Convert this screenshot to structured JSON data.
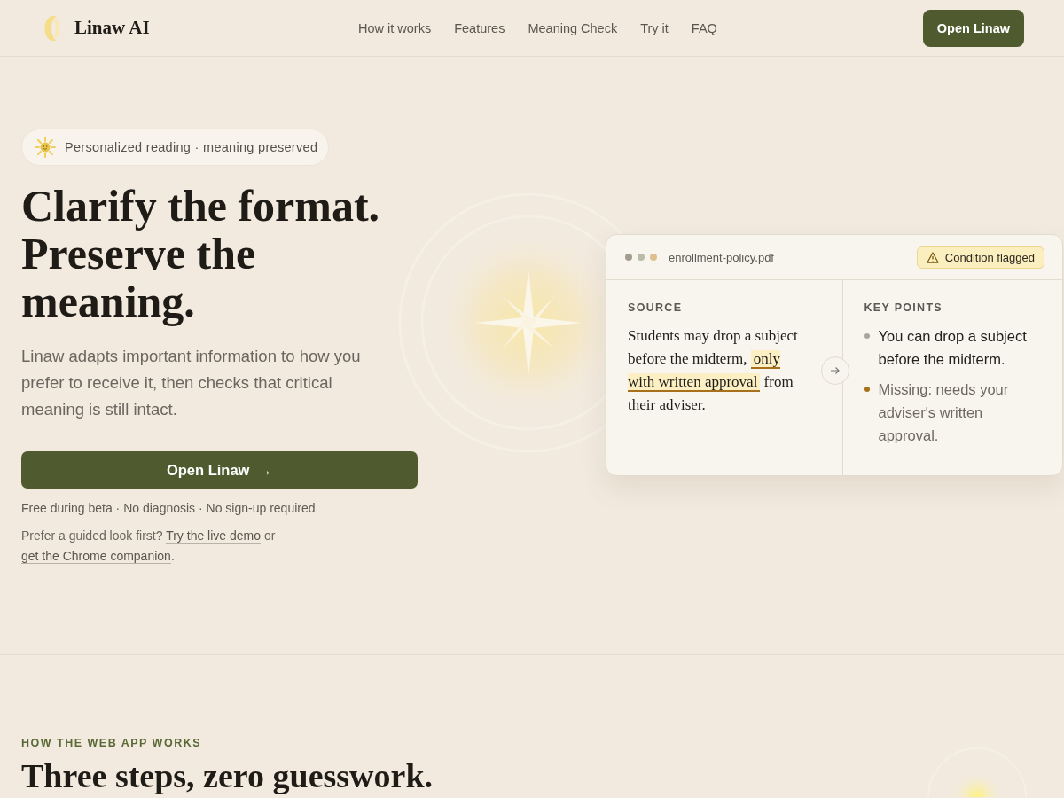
{
  "header": {
    "brand": "Linaw AI",
    "nav": [
      "How it works",
      "Features",
      "Meaning Check",
      "Try it",
      "FAQ"
    ],
    "cta": "Open Linaw"
  },
  "hero": {
    "badge": "Personalized reading · meaning preserved",
    "heading": "Clarify the format. Preserve the meaning.",
    "lead": "Linaw adapts important information to how you prefer to receive it, then checks that critical meaning is still intact.",
    "button": "Open Linaw",
    "button_icon": "→",
    "note": "Free during beta · No diagnosis · No sign-up required",
    "guide": {
      "prefix": "Prefer a guided look first?",
      "link1": "Try the live demo",
      "middle": "or",
      "link2": "get the Chrome companion",
      "suffix": "."
    }
  },
  "card": {
    "filename": "enrollment-policy.pdf",
    "flag": "Condition flagged",
    "source_label": "SOURCE",
    "source": {
      "before": "Students may drop a subject before the midterm,",
      "highlight": "only with written approval",
      "after": "from their adviser."
    },
    "points_label": "KEY POINTS",
    "points": [
      {
        "kind": "present",
        "text": "You can drop a subject before the midterm."
      },
      {
        "kind": "missing",
        "text": "Missing: needs your adviser's written approval."
      }
    ]
  },
  "section": {
    "eyebrow": "HOW THE WEB APP WORKS",
    "heading": "Three steps, zero guesswork."
  }
}
